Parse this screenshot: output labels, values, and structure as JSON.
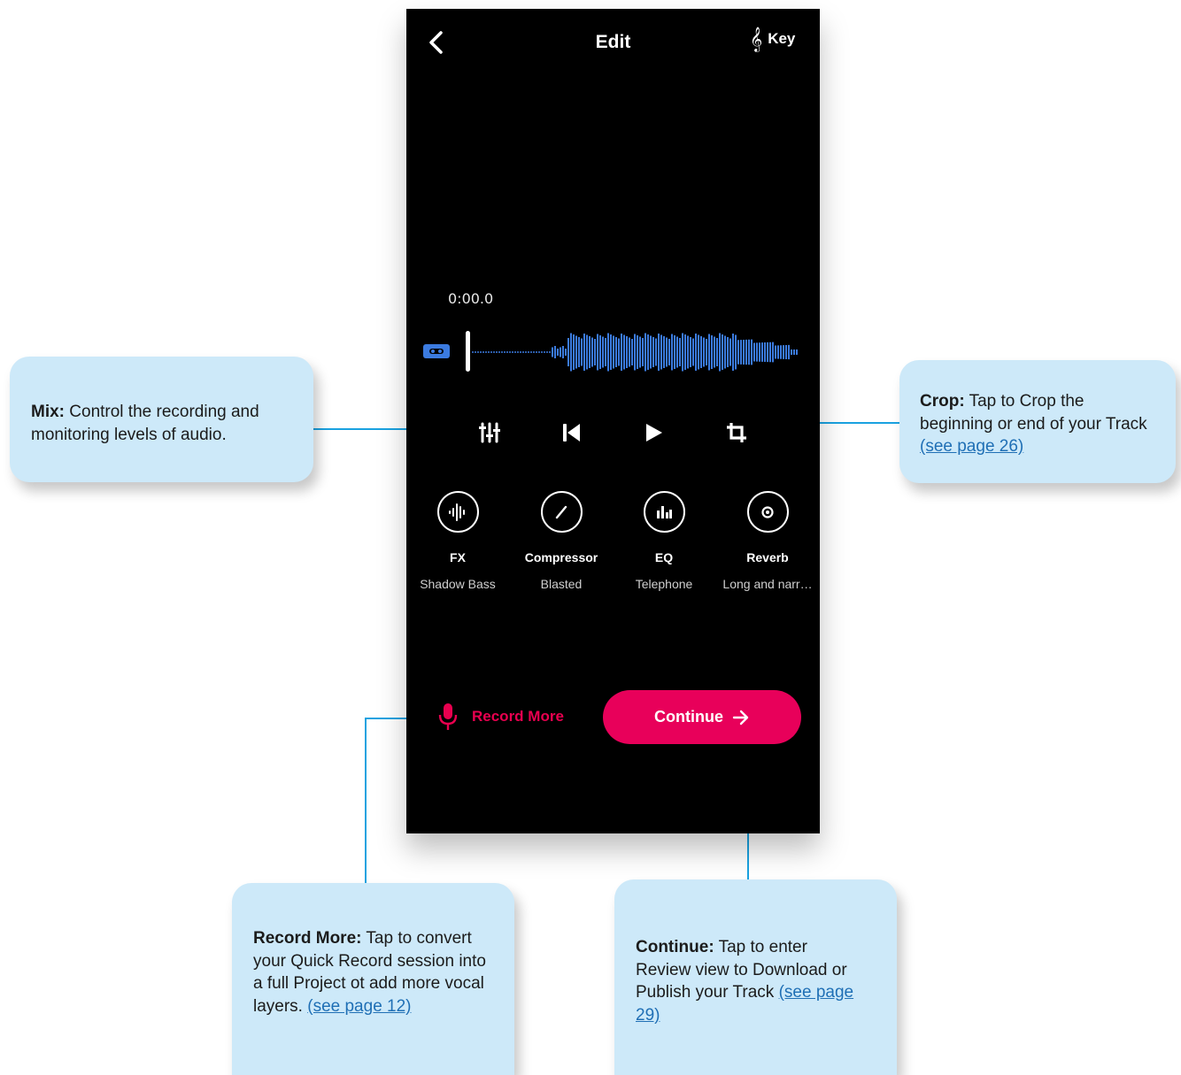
{
  "header": {
    "title": "Edit",
    "key_label": "Key",
    "clef_glyph": "𝄞"
  },
  "timeline": {
    "time": "0:00.0"
  },
  "controls": [
    "mixer-icon",
    "skip-back-icon",
    "play-icon",
    "crop-icon"
  ],
  "effects": [
    {
      "name": "FX",
      "value": "Shadow Bass",
      "icon": "waveform-icon"
    },
    {
      "name": "Compressor",
      "value": "Blasted",
      "icon": "compressor-icon"
    },
    {
      "name": "EQ",
      "value": "Telephone",
      "icon": "eq-icon"
    },
    {
      "name": "Reverb",
      "value": "Long and narr…",
      "icon": "reverb-icon"
    }
  ],
  "footer": {
    "record_more": "Record More",
    "continue": "Continue"
  },
  "callouts": {
    "mix": {
      "title": "Mix:",
      "text": " Control the recording and monitoring levels of audio."
    },
    "crop": {
      "title": "Crop:",
      "text": " Tap to Crop the beginning or end of your Track",
      "link": " (see page 26)"
    },
    "record_more": {
      "title": "Record More:",
      "text": " Tap to convert your Quick Record session into a full Project ot add more vocal layers. ",
      "link": "(see page 12)"
    },
    "continue": {
      "title": "Continue:",
      "text": " Tap to enter Review view to Download or Publish your Track ",
      "link": "(see page 29)"
    }
  },
  "colors": {
    "accent": "#e8005a",
    "callout_bg": "#cde9f9",
    "connector": "#1aa2e0",
    "waveform": "#3b7be0"
  }
}
